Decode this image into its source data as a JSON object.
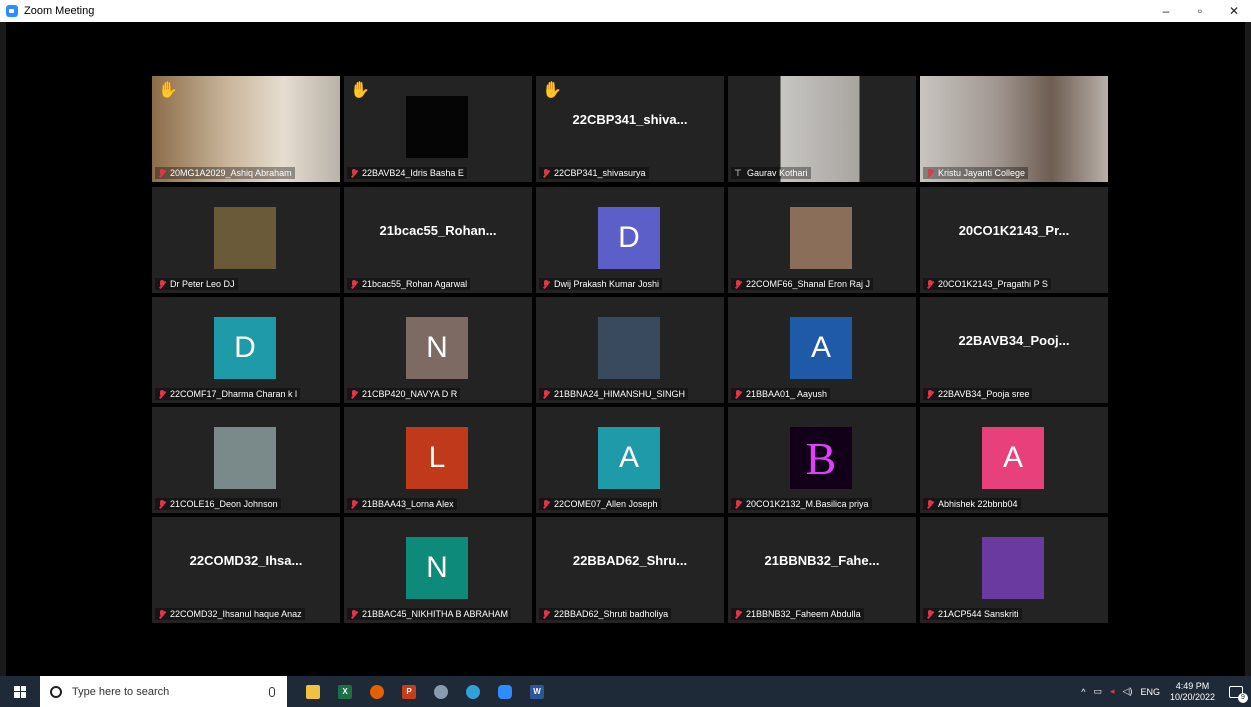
{
  "window": {
    "title": "Zoom Meeting",
    "minimize": "–",
    "maximize": "▫",
    "close": "✕"
  },
  "colors": {
    "active_border": "#b8e05a",
    "mic_off": "#e0364a",
    "hand": "#f5b01a"
  },
  "tiles": [
    {
      "label": "20MG1A2029_Ashiq Abraham",
      "kind": "video",
      "hand": true,
      "icon": "mic-off-icon"
    },
    {
      "label": "22BAVB24_Idris Basha E",
      "kind": "photo",
      "hand": true,
      "icon": "mic-off-icon"
    },
    {
      "label": "22CBP341_shivasurya",
      "kind": "name",
      "bigname": "22CBP341_shiva...",
      "hand": true,
      "icon": "mic-off-icon"
    },
    {
      "label": "Gaurav Kothari",
      "kind": "video",
      "active": true,
      "icon": "pin-icon"
    },
    {
      "label": "Kristu Jayanti College",
      "kind": "video",
      "icon": "mic-off-icon"
    },
    {
      "label": "Dr Peter Leo DJ",
      "kind": "photo",
      "icon": "mic-off-icon"
    },
    {
      "label": "21bcac55_Rohan Agarwal",
      "kind": "name",
      "bigname": "21bcac55_Rohan...",
      "icon": "mic-off-icon"
    },
    {
      "label": "Dwij Prakash Kumar Joshi",
      "kind": "letter",
      "letter": "D",
      "color": "#5b5fc7",
      "icon": "mic-off-icon"
    },
    {
      "label": "22COMF66_Shanal Eron Raj J",
      "kind": "photo",
      "icon": "mic-off-icon"
    },
    {
      "label": "20CO1K2143_Pragathi P S",
      "kind": "name",
      "bigname": "20CO1K2143_Pr...",
      "icon": "mic-off-icon"
    },
    {
      "label": "22COMF17_Dharma Charan k l",
      "kind": "letter",
      "letter": "D",
      "color": "#1e9aa8",
      "icon": "mic-off-icon"
    },
    {
      "label": "21CBP420_NAVYA D R",
      "kind": "letter",
      "letter": "N",
      "color": "#7d6a62",
      "icon": "mic-off-icon"
    },
    {
      "label": "21BBNA24_HIMANSHU_SINGH",
      "kind": "photo",
      "icon": "mic-off-icon"
    },
    {
      "label": "21BBAA01_ Aayush",
      "kind": "letter",
      "letter": "A",
      "color": "#1f5aa8",
      "icon": "mic-off-icon"
    },
    {
      "label": "22BAVB34_Pooja sree",
      "kind": "name",
      "bigname": "22BAVB34_Pooj...",
      "icon": "mic-off-icon"
    },
    {
      "label": "21COLE16_Deon Johnson",
      "kind": "photo",
      "icon": "mic-off-icon"
    },
    {
      "label": "21BBAA43_Lorna Alex",
      "kind": "letter",
      "letter": "L",
      "color": "#c0391b",
      "icon": "mic-off-icon"
    },
    {
      "label": "22COME07_Allen Joseph",
      "kind": "letter",
      "letter": "A",
      "color": "#1e9aa8",
      "icon": "mic-off-icon"
    },
    {
      "label": "20CO1K2132_M.Basilica priya",
      "kind": "neon",
      "letter": "B",
      "icon": "mic-off-icon"
    },
    {
      "label": "Abhishek 22bbnb04",
      "kind": "letter",
      "letter": "A",
      "color": "#e8407a",
      "icon": "mic-off-icon"
    },
    {
      "label": "22COMD32_Ihsanul haque Anaz",
      "kind": "name",
      "bigname": "22COMD32_Ihsa...",
      "icon": "mic-off-icon"
    },
    {
      "label": "21BBAC45_NIKHITHA B ABRAHAM",
      "kind": "letter",
      "letter": "N",
      "color": "#0e8a7a",
      "icon": "mic-off-icon"
    },
    {
      "label": "22BBAD62_Shruti badholiya",
      "kind": "name",
      "bigname": "22BBAD62_Shru...",
      "icon": "mic-off-icon"
    },
    {
      "label": "21BBNB32_Faheem Abdulla",
      "kind": "name",
      "bigname": "21BBNB32_Fahe...",
      "icon": "mic-off-icon"
    },
    {
      "label": "21ACP544 Sanskriti",
      "kind": "photo",
      "icon": "mic-off-icon"
    }
  ],
  "taskbar": {
    "search_placeholder": "Type here to search",
    "apps": [
      "file-explorer-icon",
      "excel-icon",
      "firefox-icon",
      "powerpoint-icon",
      "settings-icon",
      "edge-icon",
      "zoom-icon",
      "word-icon"
    ],
    "language": "ENG",
    "time": "4:49 PM",
    "date": "10/20/2022",
    "notifications": "9"
  }
}
